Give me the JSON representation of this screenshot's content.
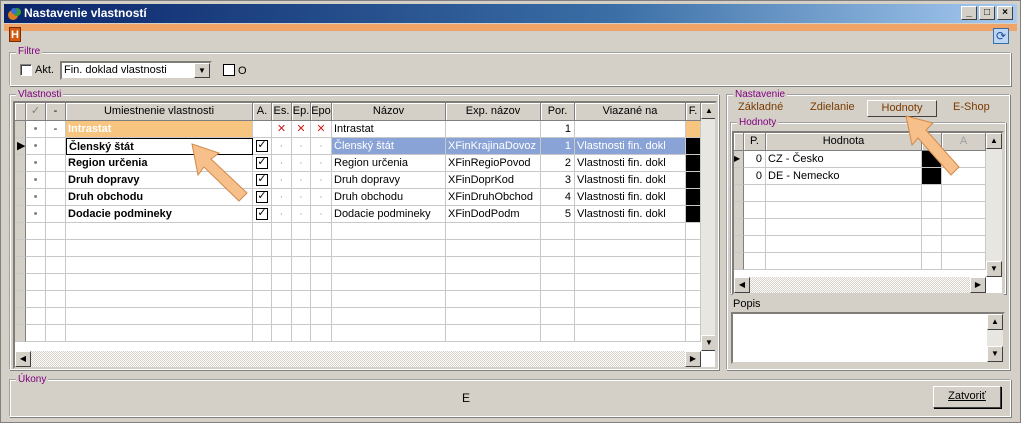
{
  "window": {
    "title": "Nastavenie vlastností",
    "controls": [
      "_",
      "□",
      "×"
    ]
  },
  "header": {
    "badge": "H"
  },
  "filter": {
    "legend": "Filtre",
    "akt_label": "Akt.",
    "select_value": "Fin. doklad vlastnosti",
    "o_label": "O"
  },
  "vlastnosti": {
    "legend": "Vlastnosti",
    "columns": [
      "✓",
      "-",
      "Umiestnenie vlastnosti",
      "A.",
      "Es.",
      "Ep.",
      "Epo",
      "Názov",
      "Exp. názov",
      "Por.",
      "Viazané na",
      "F."
    ],
    "rows": [
      {
        "dot": "•",
        "dash": "-",
        "umiestnenie": "Intrastat",
        "nazov": "Intrastat",
        "exp": "",
        "por": "1",
        "viaz": ""
      },
      {
        "dot": "•",
        "dash": "",
        "umiestnenie": "Členský štát",
        "nazov": "Členský štát",
        "exp": "XFinKrajinaDovoz",
        "por": "1",
        "viaz": "Vlastnosti fin. dokl"
      },
      {
        "dot": "•",
        "dash": "",
        "umiestnenie": "Region určenia",
        "nazov": "Region určenia",
        "exp": "XFinRegioPovod",
        "por": "2",
        "viaz": "Vlastnosti fin. dokl"
      },
      {
        "dot": "•",
        "dash": "",
        "umiestnenie": "Druh dopravy",
        "nazov": "Druh dopravy",
        "exp": "XFinDoprKod",
        "por": "3",
        "viaz": "Vlastnosti fin. dokl"
      },
      {
        "dot": "•",
        "dash": "",
        "umiestnenie": "Druh obchodu",
        "nazov": "Druh obchodu",
        "exp": "XFinDruhObchod",
        "por": "4",
        "viaz": "Vlastnosti fin. dokl"
      },
      {
        "dot": "•",
        "dash": "",
        "umiestnenie": "Dodacie podmineky",
        "nazov": "Dodacie podmineky",
        "exp": "XFinDodPodm",
        "por": "5",
        "viaz": "Vlastnosti fin. dokl"
      }
    ],
    "x_mark": "✕",
    "check_mark": "✓"
  },
  "nastavenie": {
    "legend": "Nastavenie",
    "tabs": [
      "Základné",
      "Zdielanie",
      "Hodnoty",
      "E-Shop"
    ],
    "hodnoty_legend": "Hodnoty",
    "columns": [
      "P.",
      "Hodnota",
      "",
      "A"
    ],
    "rows": [
      {
        "p": "0",
        "hodnota": "CZ - Česko"
      },
      {
        "p": "0",
        "hodnota": "DE - Nemecko"
      }
    ],
    "popis_label": "Popis"
  },
  "ukony": {
    "legend": "Úkony",
    "center": "E",
    "close_label": "Zatvoriť"
  },
  "colors": {
    "accent_orange": "#f0a468",
    "selection": "#8aa3d6",
    "arrow": "#f7c08a"
  }
}
